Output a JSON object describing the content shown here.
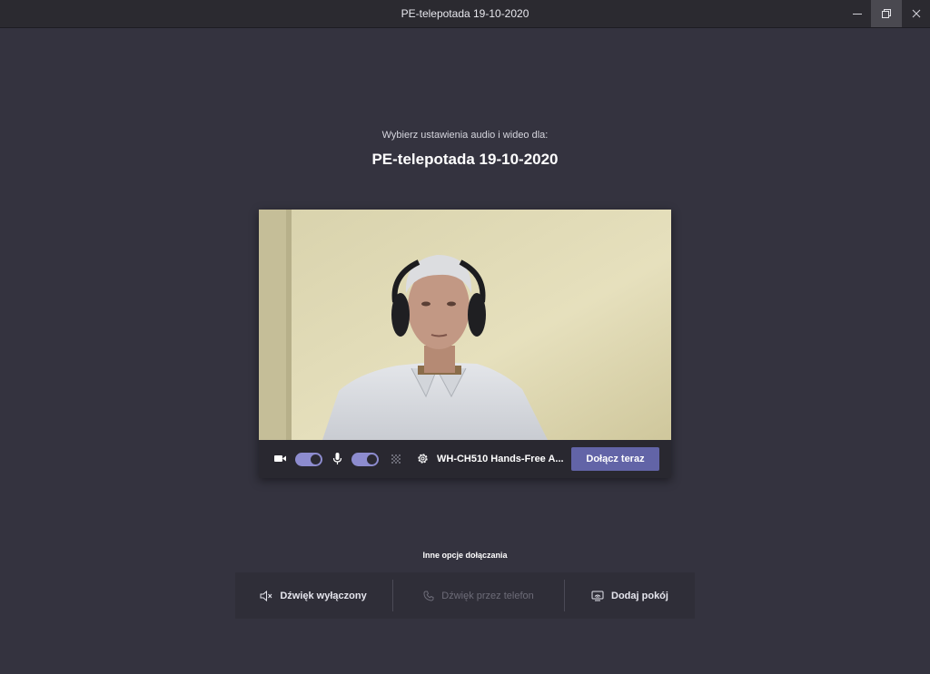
{
  "window": {
    "title": "PE-telepotada 19-10-2020"
  },
  "prejoin": {
    "subtitle": "Wybierz ustawienia audio i wideo dla:",
    "meeting_title": "PE-telepotada 19-10-2020",
    "camera_on": true,
    "mic_on": true,
    "audio_device": "WH-CH510 Hands-Free A...",
    "join_label": "Dołącz teraz"
  },
  "other_options": {
    "label": "Inne opcje dołączania",
    "items": [
      {
        "label": "Dźwięk wyłączony",
        "icon": "speaker-mute-icon",
        "enabled": true
      },
      {
        "label": "Dźwięk przez telefon",
        "icon": "phone-icon",
        "enabled": false
      },
      {
        "label": "Dodaj pokój",
        "icon": "cast-screen-icon",
        "enabled": true
      }
    ]
  },
  "colors": {
    "background": "#34333f",
    "accent": "#6264a7",
    "toggle_on": "#8d8ccf"
  }
}
